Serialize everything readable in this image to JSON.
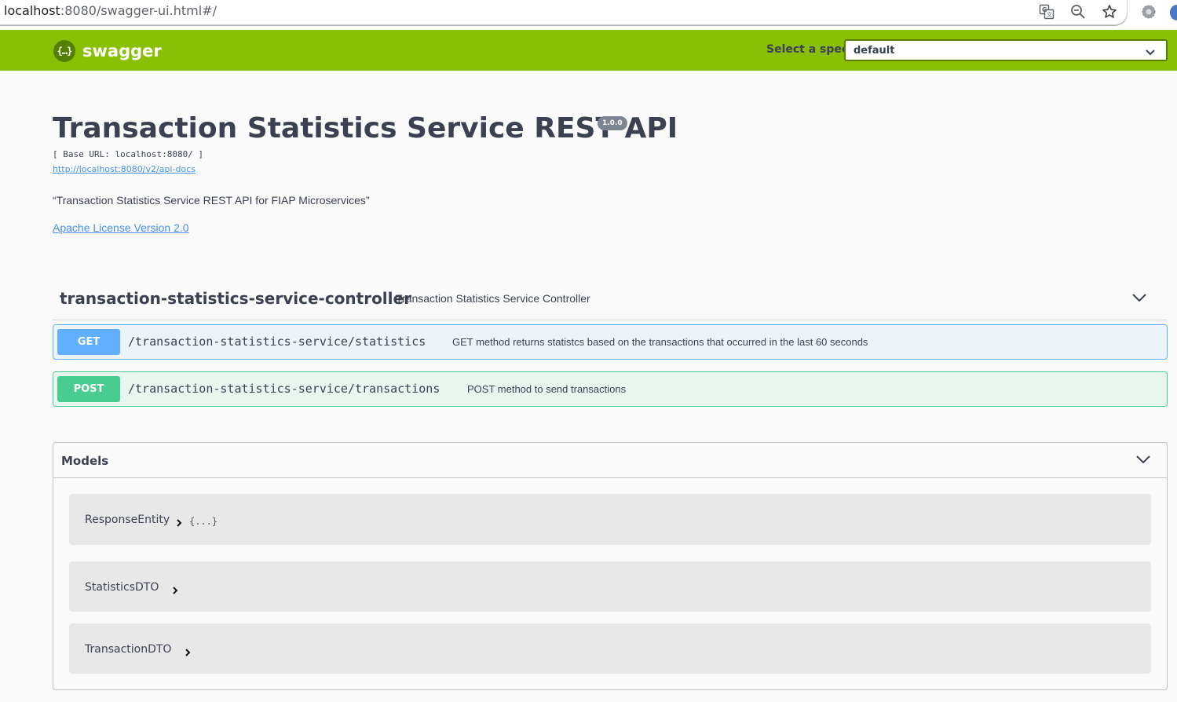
{
  "browser": {
    "url_host": "localhost",
    "url_path": ":8080/swagger-ui.html#/",
    "icons": [
      "translate-icon",
      "zoom-icon",
      "bookmark-star-icon",
      "extension-icon"
    ]
  },
  "topbar": {
    "logo_mark": "{…}",
    "logo_text": "swagger",
    "spec_label": "Select a spec",
    "spec_value": "default"
  },
  "info": {
    "title": "Transaction Statistics Service REST API",
    "version": "1.0.0",
    "base_url": "[ Base URL: localhost:8080/ ]",
    "docs_link": "http://localhost:8080/v2/api-docs",
    "description": "“Transaction Statistics Service REST API for FIAP Microservices”",
    "license": "Apache License Version 2.0"
  },
  "tag": {
    "name": "transaction-statistics-service-controller",
    "description": "Transaction Statistics Service Controller"
  },
  "operations": [
    {
      "method": "GET",
      "path": "/transaction-statistics-service/statistics",
      "summary": "GET method returns statistcs based on the transactions that occurred in the last 60 seconds"
    },
    {
      "method": "POST",
      "path": "/transaction-statistics-service/transactions",
      "summary": "POST method to send transactions"
    }
  ],
  "models": {
    "title": "Models",
    "items": [
      {
        "name": "ResponseEntity",
        "collapsed_preview": "{...}"
      },
      {
        "name": "StatisticsDTO"
      },
      {
        "name": "TransactionDTO"
      }
    ]
  },
  "colors": {
    "topbar": "#89bf04",
    "get": "#61affe",
    "post": "#49cc90",
    "text": "#3b4151",
    "link": "#4990e2"
  }
}
